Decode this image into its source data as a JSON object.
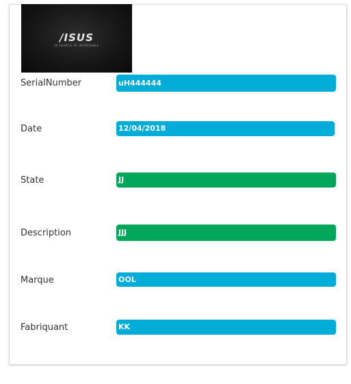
{
  "image": {
    "logo_text": "/ISUS",
    "logo_tagline": "IN SEARCH OF INCREDIBLE"
  },
  "colors": {
    "info": "#00acd8",
    "success": "#00a65a"
  },
  "fields": [
    {
      "label": "SerialNumber",
      "value": "uH444444",
      "color": "info"
    },
    {
      "label": "Date",
      "value": "12/04/2018",
      "color": "info"
    },
    {
      "label": "State",
      "value": "JJ",
      "color": "success"
    },
    {
      "label": "Description",
      "value": "JJJ",
      "color": "success"
    },
    {
      "label": "Marque",
      "value": "OOL",
      "color": "info"
    },
    {
      "label": "Fabriquant",
      "value": "KK",
      "color": "info"
    }
  ]
}
